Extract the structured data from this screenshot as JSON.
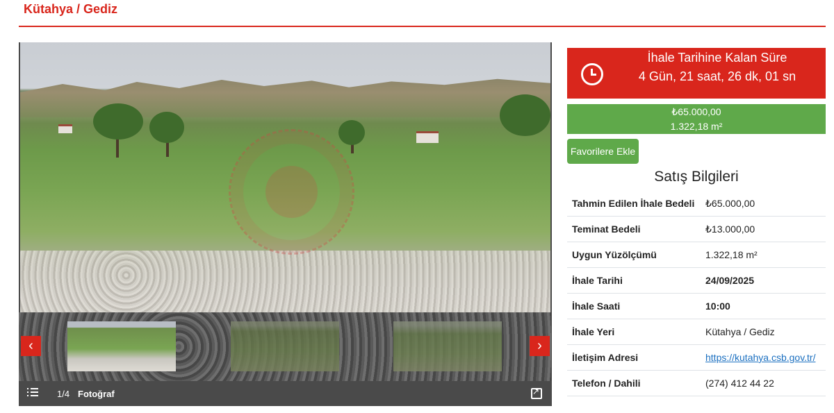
{
  "page": {
    "title": "Kütahya / Gediz"
  },
  "countdown": {
    "title": "İhale Tarihine Kalan Süre",
    "value": "4 Gün, 21 saat, 26 dk, 01 sn",
    "icon": "clock-icon"
  },
  "price": {
    "amount": "₺65.000,00",
    "area": "1.322,18 m²"
  },
  "favorites": {
    "label": "Favorilere Ekle"
  },
  "sale_info": {
    "title": "Satış Bilgileri",
    "rows": [
      {
        "key": "Tahmin Edilen İhale Bedeli",
        "value": "₺65.000,00"
      },
      {
        "key": "Teminat Bedeli",
        "value": "₺13.000,00"
      },
      {
        "key": "Uygun Yüzölçümü",
        "value": "1.322,18 m²"
      },
      {
        "key": "İhale Tarihi",
        "value": "24/09/2025"
      },
      {
        "key": "İhale Saati",
        "value": "10:00"
      },
      {
        "key": "İhale Yeri",
        "value": "Kütahya / Gediz"
      },
      {
        "key": "İletişim Adresi",
        "value": "https://kutahya.csb.gov.tr/"
      },
      {
        "key": "Telefon / Dahili",
        "value": "(274) 412 44 22"
      }
    ]
  },
  "gallery": {
    "counter": "1/4",
    "label": "Fotoğraf",
    "prev_glyph": "‹",
    "next_glyph": "›"
  },
  "colors": {
    "accent_red": "#d9261c",
    "accent_green": "#5fa94a",
    "link_blue": "#1a6fc0"
  }
}
